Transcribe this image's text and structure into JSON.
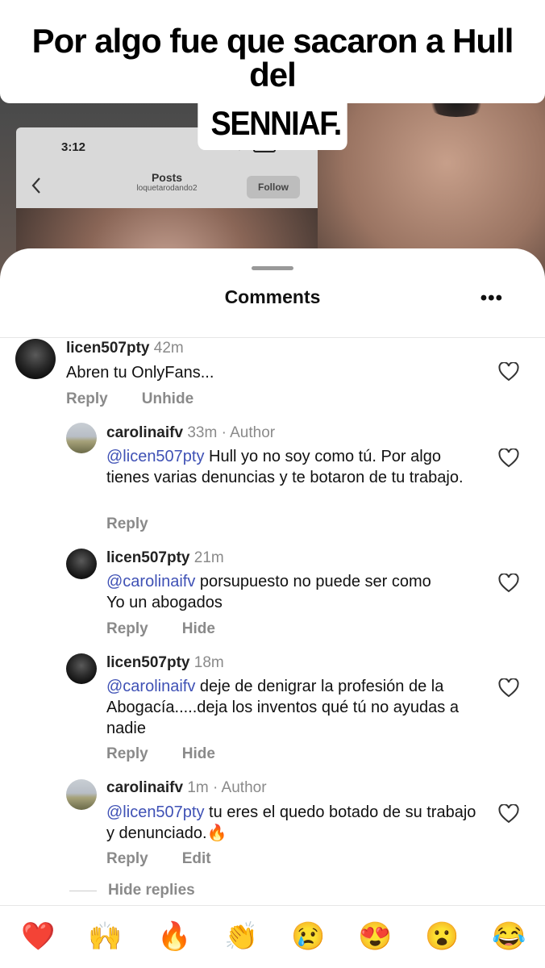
{
  "caption": {
    "line1": "Por algo fue que sacaron a Hull del",
    "line2": "SENNIAF."
  },
  "embedded_post": {
    "time": "3:12",
    "title": "Posts",
    "username": "loquetarodando2",
    "follow_label": "Follow",
    "icons": [
      "back-chevron-icon",
      "wifi-icon",
      "battery-icon"
    ]
  },
  "sheet": {
    "title": "Comments",
    "more": "•••"
  },
  "comments": [
    {
      "user": "licen507pty",
      "meta": "42m",
      "mention": "",
      "text": "Abren tu OnlyFans...",
      "actions": [
        "Reply",
        "Unhide"
      ]
    },
    {
      "user": "carolinaifv",
      "meta": "33m · Author",
      "mention": "@licen507pty",
      "text": " Hull yo no soy como tú. Por algo tienes varias denuncias y te botaron de tu trabajo.",
      "actions": [
        "Reply"
      ]
    },
    {
      "user": "licen507pty",
      "meta": "21m",
      "mention": "@carolinaifv",
      "text": " porsupuesto no puede ser como Yo un abogados",
      "actions": [
        "Reply",
        "Hide"
      ]
    },
    {
      "user": "licen507pty",
      "meta": "18m",
      "mention": "@carolinaifv",
      "text": " deje de denigrar la profesión de la Abogacía.....deja los inventos qué tú no ayudas a nadie",
      "actions": [
        "Reply",
        "Hide"
      ]
    },
    {
      "user": "carolinaifv",
      "meta": "1m · Author",
      "mention": "@licen507pty",
      "text": " tu eres el quedo botado de su trabajo y denunciado.🔥",
      "actions": [
        "Reply",
        "Edit"
      ]
    }
  ],
  "hide_replies_label": "Hide replies",
  "emoji_bar": [
    "❤️",
    "🙌",
    "🔥",
    "👏",
    "😢",
    "😍",
    "😮",
    "😂"
  ]
}
